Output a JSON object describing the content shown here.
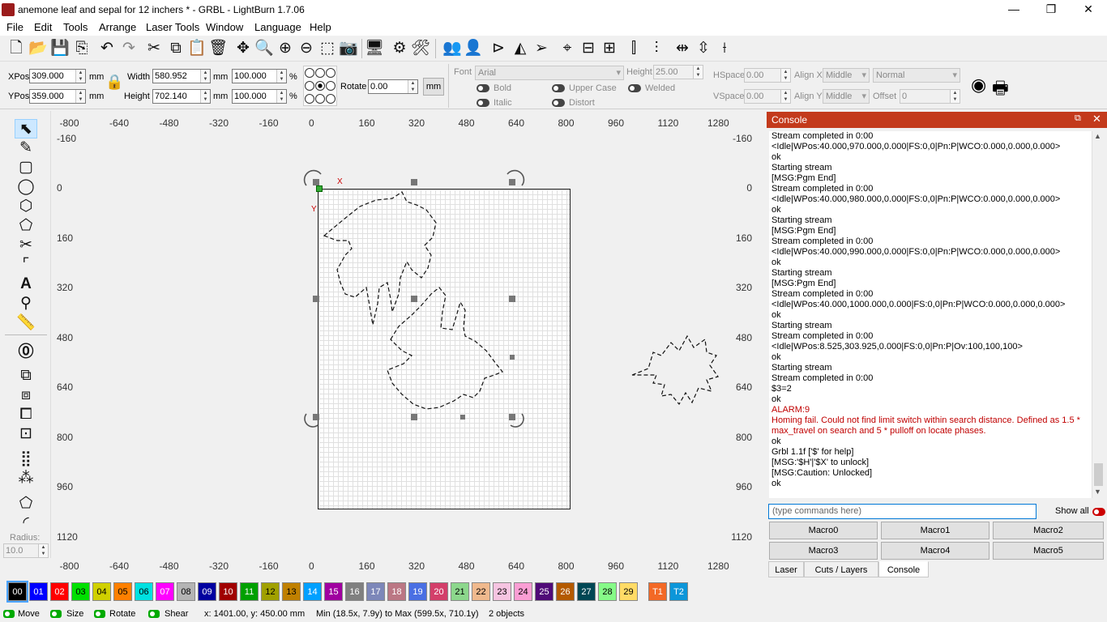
{
  "window": {
    "title": "anemone leaf and sepal for 12 inchers * - GRBL - LightBurn 1.7.06",
    "minimize": "—",
    "restore": "❐",
    "close": "✕"
  },
  "menu": [
    "File",
    "Edit",
    "Tools",
    "Arrange",
    "Laser Tools",
    "Window",
    "Language",
    "Help"
  ],
  "toolbar_icons": [
    "new-file-icon",
    "open-file-icon",
    "save-icon",
    "import-icon",
    "undo-icon",
    "redo-icon",
    "cut-icon",
    "copy-icon",
    "paste-icon",
    "delete-icon",
    "move-icon",
    "zoom-icon",
    "zoom-in-icon",
    "zoom-out-icon",
    "frame-icon",
    "camera-icon",
    "monitor-icon",
    "settings-icon",
    "tools-icon",
    "group-icon",
    "user-icon",
    "flip-h-icon",
    "mirror-icon",
    "send-icon",
    "target-icon",
    "align-icon",
    "distribute-icon",
    "arrange-h-icon",
    "arrange-v-icon",
    "space-h-icon",
    "space-v-icon",
    "cross-icon"
  ],
  "props": {
    "xpos_label": "XPos",
    "xpos": "309.000",
    "ypos_label": "YPos",
    "ypos": "359.000",
    "unit": "mm",
    "width_label": "Width",
    "width": "580.952",
    "height_label": "Height",
    "height": "702.140",
    "scale_w": "100.000",
    "scale_h": "100.000",
    "pct": "%",
    "rotate_label": "Rotate",
    "rotate": "0.00",
    "mm_button": "mm",
    "font_label": "Font",
    "font": "Arial",
    "fheight_label": "Height",
    "fheight": "25.00",
    "hspace_label": "HSpace",
    "hspace": "0.00",
    "vspace_label": "VSpace",
    "vspace": "0.00",
    "alignx_label": "Align X",
    "alignx": "Middle",
    "aligny_label": "Align Y",
    "aligny": "Middle",
    "normal": "Normal",
    "offset_label": "Offset",
    "offset": "0",
    "bold": "Bold",
    "italic": "Italic",
    "upper": "Upper Case",
    "distort": "Distort",
    "welded": "Welded"
  },
  "left_tools": [
    "select-icon",
    "pen-icon",
    "rectangle-icon",
    "ellipse-icon",
    "polygon-icon",
    "pentagon-icon",
    "edit-nodes-icon",
    "crop-icon",
    "text-icon",
    "position-icon",
    "measure-icon",
    "offset-icon",
    "boolean-union-icon",
    "boolean-diff-icon",
    "boolean-intersect-icon",
    "weld-icon",
    "array-icon",
    "circular-array-icon",
    "tab-icon",
    "corner-icon"
  ],
  "radius_label": "Radius:",
  "radius": "10.0",
  "ruler": {
    "x": [
      "-800",
      "-640",
      "-480",
      "-320",
      "-160",
      "0",
      "160",
      "320",
      "480",
      "640",
      "800",
      "960",
      "1120",
      "1280"
    ],
    "y": [
      "-160",
      "0",
      "160",
      "320",
      "480",
      "640",
      "800",
      "960",
      "1120"
    ]
  },
  "canvas": {
    "x_marker": "X",
    "y_marker": "Y"
  },
  "console": {
    "title": "Console",
    "lines": [
      {
        "t": "Stream completed in 0:00",
        "c": ""
      },
      {
        "t": "<Idle|WPos:40.000,970.000,0.000|FS:0,0|Pn:P|WCO:0.000,0.000,0.000>",
        "c": ""
      },
      {
        "t": "ok",
        "c": ""
      },
      {
        "t": "Starting stream",
        "c": ""
      },
      {
        "t": "[MSG:Pgm End]",
        "c": ""
      },
      {
        "t": "Stream completed in 0:00",
        "c": ""
      },
      {
        "t": "<Idle|WPos:40.000,980.000,0.000|FS:0,0|Pn:P|WCO:0.000,0.000,0.000>",
        "c": ""
      },
      {
        "t": "ok",
        "c": ""
      },
      {
        "t": "Starting stream",
        "c": ""
      },
      {
        "t": "[MSG:Pgm End]",
        "c": ""
      },
      {
        "t": "Stream completed in 0:00",
        "c": ""
      },
      {
        "t": "<Idle|WPos:40.000,990.000,0.000|FS:0,0|Pn:P|WCO:0.000,0.000,0.000>",
        "c": ""
      },
      {
        "t": "ok",
        "c": ""
      },
      {
        "t": "Starting stream",
        "c": ""
      },
      {
        "t": "[MSG:Pgm End]",
        "c": ""
      },
      {
        "t": "Stream completed in 0:00",
        "c": ""
      },
      {
        "t": "<Idle|WPos:40.000,1000.000,0.000|FS:0,0|Pn:P|WCO:0.000,0.000,0.000>",
        "c": ""
      },
      {
        "t": "ok",
        "c": ""
      },
      {
        "t": "Starting stream",
        "c": ""
      },
      {
        "t": "Stream completed in 0:00",
        "c": ""
      },
      {
        "t": "<Idle|WPos:8.525,303.925,0.000|FS:0,0|Pn:P|Ov:100,100,100>",
        "c": ""
      },
      {
        "t": "ok",
        "c": ""
      },
      {
        "t": "Starting stream",
        "c": ""
      },
      {
        "t": "Stream completed in 0:00",
        "c": ""
      },
      {
        "t": "$3=2",
        "c": ""
      },
      {
        "t": "ok",
        "c": ""
      },
      {
        "t": "ALARM:9",
        "c": "red"
      },
      {
        "t": "Homing fail. Could not find limit switch within search distance. Defined as 1.5 * max_travel on search and 5 * pulloff on locate phases.",
        "c": "red"
      },
      {
        "t": "ok",
        "c": ""
      },
      {
        "t": "Grbl 1.1f ['$' for help]",
        "c": ""
      },
      {
        "t": "[MSG:'$H'|'$X' to unlock]",
        "c": ""
      },
      {
        "t": "[MSG:Caution: Unlocked]",
        "c": ""
      },
      {
        "t": "ok",
        "c": ""
      }
    ],
    "placeholder": "(type commands here)",
    "show_all": "Show all",
    "macros": [
      "Macro0",
      "Macro1",
      "Macro2",
      "Macro3",
      "Macro4",
      "Macro5"
    ],
    "tabs": [
      "Laser",
      "Cuts / Layers",
      "Console"
    ]
  },
  "palette": [
    {
      "n": "00",
      "c": "#000000",
      "t": "#ffffff"
    },
    {
      "n": "01",
      "c": "#0000ff",
      "t": "#ffffff"
    },
    {
      "n": "02",
      "c": "#ff0000",
      "t": "#ffffff"
    },
    {
      "n": "03",
      "c": "#00e000",
      "t": "#000000"
    },
    {
      "n": "04",
      "c": "#d0d000",
      "t": "#000000"
    },
    {
      "n": "05",
      "c": "#ff8000",
      "t": "#000000"
    },
    {
      "n": "06",
      "c": "#00e0e0",
      "t": "#000000"
    },
    {
      "n": "07",
      "c": "#ff00ff",
      "t": "#ffffff"
    },
    {
      "n": "08",
      "c": "#b4b4b4",
      "t": "#000000"
    },
    {
      "n": "09",
      "c": "#0000a0",
      "t": "#ffffff"
    },
    {
      "n": "10",
      "c": "#a00000",
      "t": "#ffffff"
    },
    {
      "n": "11",
      "c": "#00a000",
      "t": "#ffffff"
    },
    {
      "n": "12",
      "c": "#a0a000",
      "t": "#000000"
    },
    {
      "n": "13",
      "c": "#c08000",
      "t": "#000000"
    },
    {
      "n": "14",
      "c": "#00a0ff",
      "t": "#ffffff"
    },
    {
      "n": "15",
      "c": "#a000a0",
      "t": "#ffffff"
    },
    {
      "n": "16",
      "c": "#808080",
      "t": "#ffffff"
    },
    {
      "n": "17",
      "c": "#7d87b9",
      "t": "#ffffff"
    },
    {
      "n": "18",
      "c": "#bb7784",
      "t": "#ffffff"
    },
    {
      "n": "19",
      "c": "#4a6fe3",
      "t": "#ffffff"
    },
    {
      "n": "20",
      "c": "#d33f6a",
      "t": "#ffffff"
    },
    {
      "n": "21",
      "c": "#8cd78c",
      "t": "#000000"
    },
    {
      "n": "22",
      "c": "#f0b98d",
      "t": "#000000"
    },
    {
      "n": "23",
      "c": "#f6c4e1",
      "t": "#000000"
    },
    {
      "n": "24",
      "c": "#fa9ed4",
      "t": "#000000"
    },
    {
      "n": "25",
      "c": "#500a78",
      "t": "#ffffff"
    },
    {
      "n": "26",
      "c": "#b45a00",
      "t": "#ffffff"
    },
    {
      "n": "27",
      "c": "#004754",
      "t": "#ffffff"
    },
    {
      "n": "28",
      "c": "#86fa88",
      "t": "#000000"
    },
    {
      "n": "29",
      "c": "#ffdb66",
      "t": "#000000"
    },
    {
      "n": "T1",
      "c": "#f36926",
      "t": "#ffffff"
    },
    {
      "n": "T2",
      "c": "#0c96d9",
      "t": "#ffffff"
    }
  ],
  "status": {
    "move": "Move",
    "size": "Size",
    "rotate": "Rotate",
    "shear": "Shear",
    "coords": "x: 1401.00, y: 450.00 mm",
    "range": "Min (18.5x, 7.9y) to Max (599.5x, 710.1y)",
    "count": "2 objects"
  }
}
